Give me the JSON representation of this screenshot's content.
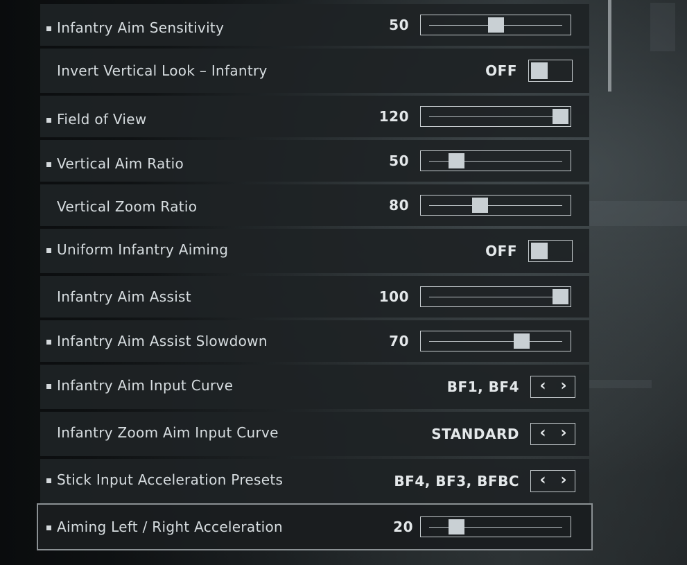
{
  "colors": {
    "row_bg": "#1e2225",
    "text": "#d7dde0",
    "control": "#c9d0d4",
    "selected_outline": "#8b9194"
  },
  "settings": [
    {
      "label": "Infantry Aim Sensitivity",
      "bullet": true,
      "value": "50",
      "control": "slider",
      "level": 0.5
    },
    {
      "label": "Invert Vertical Look – Infantry",
      "bullet": false,
      "value": "OFF",
      "control": "toggle"
    },
    {
      "label": "Field of View",
      "bullet": true,
      "value": "120",
      "control": "slider",
      "level": 1.0
    },
    {
      "label": "Vertical Aim Ratio",
      "bullet": true,
      "value": "50",
      "control": "slider",
      "level": 0.2
    },
    {
      "label": "Vertical Zoom Ratio",
      "bullet": false,
      "value": "80",
      "control": "slider",
      "level": 0.38
    },
    {
      "label": "Uniform Infantry Aiming",
      "bullet": true,
      "value": "OFF",
      "control": "toggle"
    },
    {
      "label": "Infantry Aim Assist",
      "bullet": false,
      "value": "100",
      "control": "slider",
      "level": 1.0
    },
    {
      "label": "Infantry Aim Assist Slowdown",
      "bullet": true,
      "value": "70",
      "control": "slider",
      "level": 0.7
    },
    {
      "label": "Infantry Aim Input Curve",
      "bullet": true,
      "value": "BF1, BF4",
      "control": "stepper"
    },
    {
      "label": "Infantry Zoom Aim Input Curve",
      "bullet": false,
      "value": "STANDARD",
      "control": "stepper"
    },
    {
      "label": "Stick Input Acceleration Presets",
      "bullet": true,
      "value": "BF4, BF3, BFBC",
      "control": "stepper"
    },
    {
      "label": "Aiming Left / Right Acceleration",
      "bullet": true,
      "value": "20",
      "control": "slider",
      "level": 0.2,
      "selected": true
    }
  ]
}
